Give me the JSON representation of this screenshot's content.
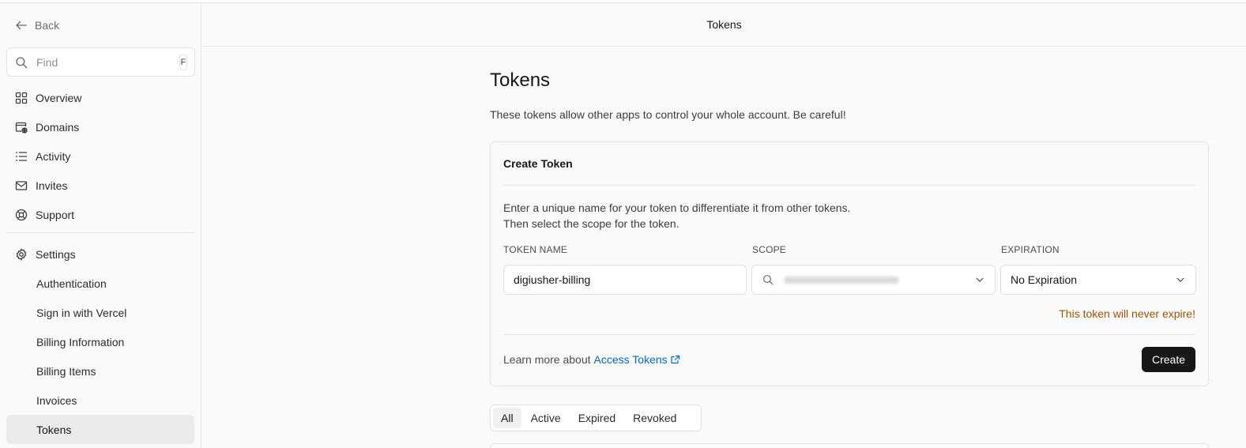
{
  "sidebar": {
    "back_label": "Back",
    "find_placeholder": "Find",
    "find_shortcut": "F",
    "items": [
      {
        "label": "Overview",
        "icon": "grid-icon"
      },
      {
        "label": "Domains",
        "icon": "domain-globe-icon"
      },
      {
        "label": "Activity",
        "icon": "list-icon"
      },
      {
        "label": "Invites",
        "icon": "mail-icon"
      },
      {
        "label": "Support",
        "icon": "lifebuoy-icon"
      }
    ],
    "settings_label": "Settings",
    "settings_items": [
      {
        "label": "Authentication"
      },
      {
        "label": "Sign in with Vercel"
      },
      {
        "label": "Billing Information"
      },
      {
        "label": "Billing Items"
      },
      {
        "label": "Invoices"
      },
      {
        "label": "Tokens"
      }
    ],
    "active_item": "Tokens"
  },
  "header": {
    "title": "Tokens"
  },
  "main": {
    "title": "Tokens",
    "description": "These tokens allow other apps to control your whole account. Be careful!",
    "create_card": {
      "title": "Create Token",
      "desc_line1": "Enter a unique name for your token to differentiate it from other tokens.",
      "desc_line2": "Then select the scope for the token.",
      "token_name_label": "TOKEN NAME",
      "token_name_value": "digiusher-billing",
      "scope_label": "SCOPE",
      "expiration_label": "EXPIRATION",
      "expiration_value": "No Expiration",
      "warning": "This token will never expire!",
      "learn_prefix": "Learn more about",
      "learn_link": "Access Tokens",
      "create_label": "Create"
    },
    "tabs": [
      {
        "label": "All"
      },
      {
        "label": "Active"
      },
      {
        "label": "Expired"
      },
      {
        "label": "Revoked"
      }
    ],
    "active_tab": "All"
  },
  "colors": {
    "accent_link": "#0068d6",
    "warning": "#a35200",
    "primary_button": "#171717"
  }
}
